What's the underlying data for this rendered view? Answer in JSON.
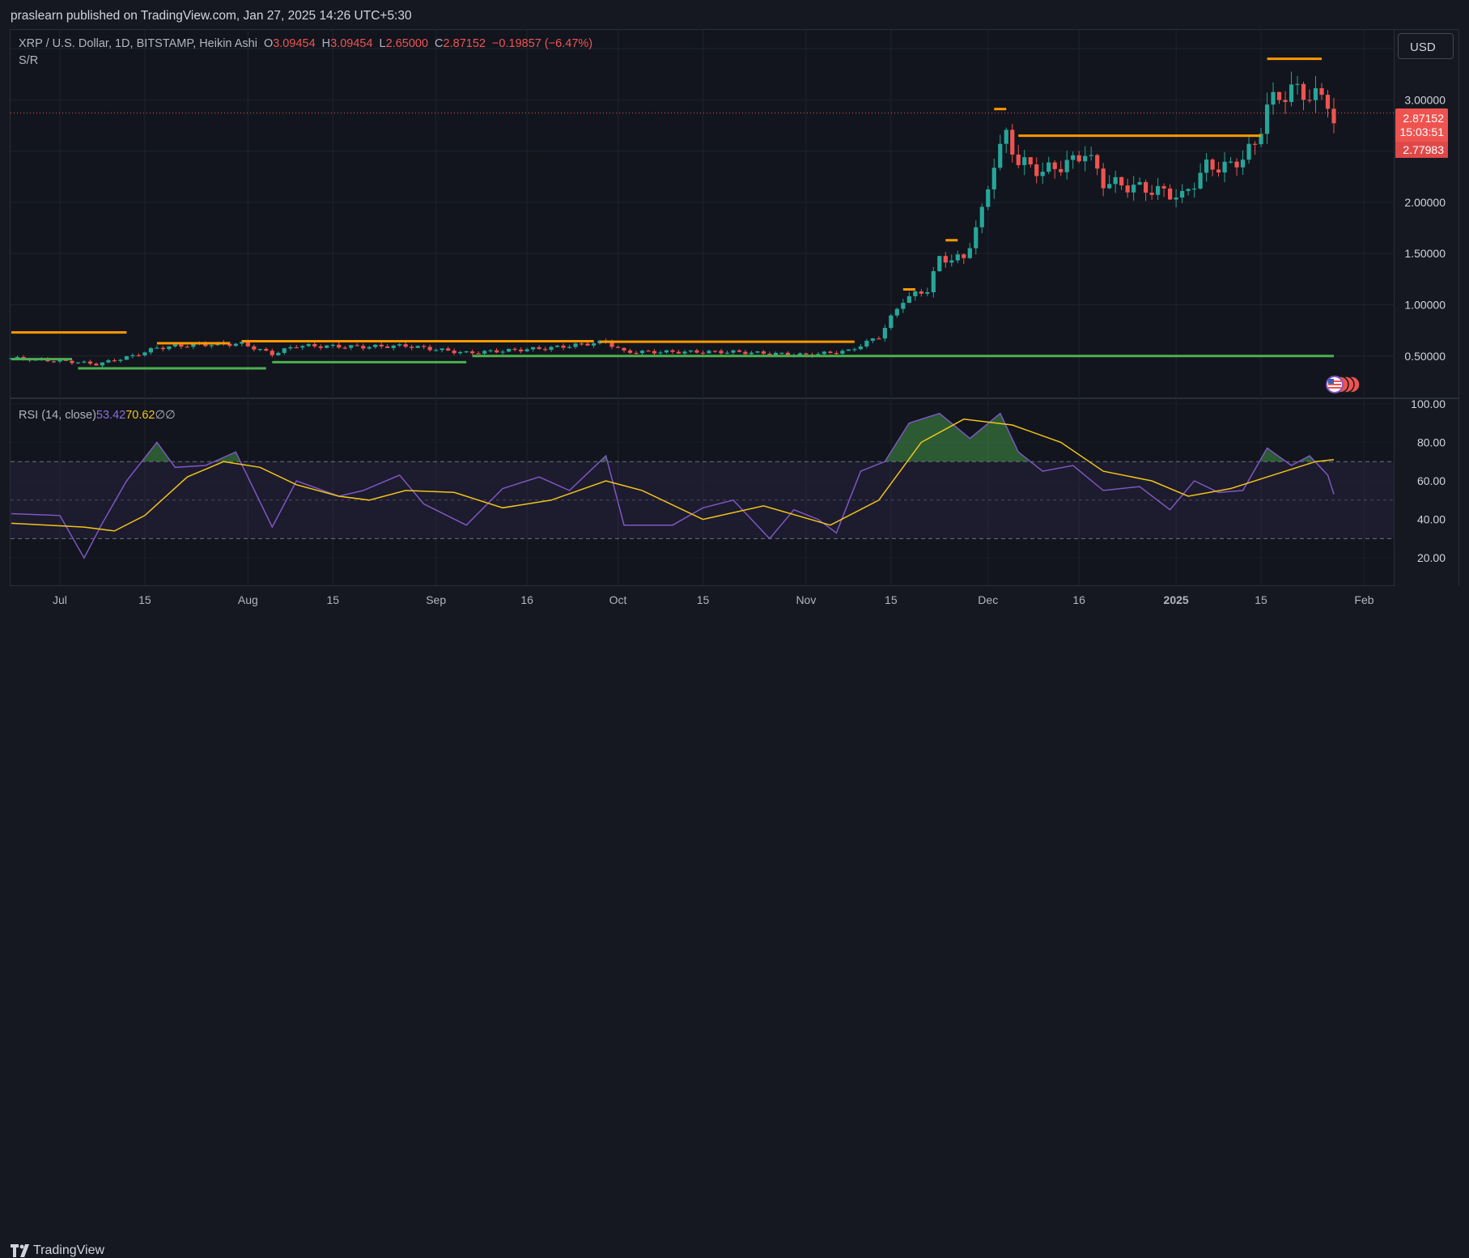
{
  "header": {
    "published_text": "praslearn published on TradingView.com, Jan 27, 2025 14:26 UTC+5:30"
  },
  "legend": {
    "title": "XRP / U.S. Dollar, 1D, BITSTAMP, Heikin Ashi",
    "o_label": "O",
    "o_value": "3.09454",
    "h_label": "H",
    "h_value": "3.09454",
    "l_label": "L",
    "l_value": "2.65000",
    "c_label": "C",
    "c_value": "2.87152",
    "change": "−0.19857 (−6.47%)",
    "indicator": "S/R"
  },
  "rsi_legend": {
    "title": "RSI (14, close)",
    "rsi_value": "53.42",
    "ma_value": "70.62",
    "sym1": "∅",
    "sym2": "∅"
  },
  "currency_button": "USD",
  "price_tags": {
    "last": "2.87152",
    "countdown": "15:03:51",
    "ha_close": "2.77983"
  },
  "footer": {
    "brand": "TradingView"
  },
  "colors": {
    "up": "#26a69a",
    "down": "#ef5350",
    "resistance": "#ff9800",
    "support": "#4caf50",
    "rsi": "#7e57c2",
    "rsi_ma": "#f0c419",
    "background": "#12151d",
    "grid": "#1f232e"
  },
  "chart_data": [
    {
      "type": "candlestick",
      "title": "XRP / U.S. Dollar, 1D, BITSTAMP, Heikin Ashi",
      "ylim": [
        0.0,
        3.6
      ],
      "y_ticks": [
        "0.50000",
        "1.00000",
        "1.50000",
        "2.00000",
        "3.00000"
      ],
      "x_ticks": [
        "Jul",
        "15",
        "Aug",
        "15",
        "Sep",
        "16",
        "Oct",
        "15",
        "Nov",
        "15",
        "Dec",
        "16",
        "2025",
        "15",
        "Feb"
      ],
      "date_range": [
        "2024-06-23",
        "2025-01-27"
      ],
      "close_path": [
        [
          "2024-06-23",
          0.48
        ],
        [
          "2024-07-04",
          0.44
        ],
        [
          "2024-07-07",
          0.42
        ],
        [
          "2024-07-13",
          0.5
        ],
        [
          "2024-07-17",
          0.58
        ],
        [
          "2024-07-23",
          0.61
        ],
        [
          "2024-07-31",
          0.62
        ],
        [
          "2024-08-05",
          0.52
        ],
        [
          "2024-08-09",
          0.6
        ],
        [
          "2024-08-20",
          0.59
        ],
        [
          "2024-08-27",
          0.6
        ],
        [
          "2024-09-06",
          0.53
        ],
        [
          "2024-09-20",
          0.58
        ],
        [
          "2024-09-29",
          0.64
        ],
        [
          "2024-10-02",
          0.54
        ],
        [
          "2024-10-20",
          0.54
        ],
        [
          "2024-11-01",
          0.51
        ],
        [
          "2024-11-08",
          0.55
        ],
        [
          "2024-11-13",
          0.69
        ],
        [
          "2024-11-17",
          1.05
        ],
        [
          "2024-11-21",
          1.15
        ],
        [
          "2024-11-23",
          1.45
        ],
        [
          "2024-11-27",
          1.45
        ],
        [
          "2024-11-30",
          1.9
        ],
        [
          "2024-12-02",
          2.4
        ],
        [
          "2024-12-04",
          2.65
        ],
        [
          "2024-12-06",
          2.4
        ],
        [
          "2024-12-10",
          2.3
        ],
        [
          "2024-12-15",
          2.4
        ],
        [
          "2024-12-17",
          2.5
        ],
        [
          "2024-12-20",
          2.2
        ],
        [
          "2024-12-30",
          2.1
        ],
        [
          "2025-01-02",
          2.05
        ],
        [
          "2025-01-06",
          2.35
        ],
        [
          "2025-01-10",
          2.35
        ],
        [
          "2025-01-14",
          2.55
        ],
        [
          "2025-01-16",
          2.95
        ],
        [
          "2025-01-20",
          3.1
        ],
        [
          "2025-01-26",
          3.0
        ],
        [
          "2025-01-27",
          2.78
        ]
      ],
      "last_price": 2.87152,
      "sr_lines": [
        {
          "kind": "resistance",
          "from": "2024-06-23",
          "to": "2024-07-12",
          "value": 0.73
        },
        {
          "kind": "resistance",
          "from": "2024-07-17",
          "to": "2024-07-29",
          "value": 0.625
        },
        {
          "kind": "resistance",
          "from": "2024-07-31",
          "to": "2024-09-27",
          "value": 0.645
        },
        {
          "kind": "resistance",
          "from": "2024-09-28",
          "to": "2024-11-09",
          "value": 0.64
        },
        {
          "kind": "resistance",
          "from": "2024-11-17",
          "to": "2024-11-19",
          "value": 1.15
        },
        {
          "kind": "resistance",
          "from": "2024-11-24",
          "to": "2024-11-26",
          "value": 1.63
        },
        {
          "kind": "resistance",
          "from": "2024-12-02",
          "to": "2024-12-04",
          "value": 2.91
        },
        {
          "kind": "resistance",
          "from": "2024-12-06",
          "to": "2025-01-15",
          "value": 2.65
        },
        {
          "kind": "resistance",
          "from": "2025-01-16",
          "to": "2025-01-25",
          "value": 3.4
        },
        {
          "kind": "support",
          "from": "2024-06-23",
          "to": "2024-07-03",
          "value": 0.47
        },
        {
          "kind": "support",
          "from": "2024-07-04",
          "to": "2024-08-04",
          "value": 0.38
        },
        {
          "kind": "support",
          "from": "2024-08-05",
          "to": "2024-09-06",
          "value": 0.44
        },
        {
          "kind": "support",
          "from": "2024-09-07",
          "to": "2025-01-27",
          "value": 0.5
        }
      ]
    },
    {
      "type": "line",
      "title": "RSI (14, close)",
      "ylim": [
        10,
        105
      ],
      "y_ticks": [
        "20.00",
        "40.00",
        "60.00",
        "80.00",
        "100.00"
      ],
      "bands": [
        30,
        50,
        70
      ],
      "series": [
        {
          "key": "rsi",
          "points": [
            [
              "2024-06-23",
              43
            ],
            [
              "2024-07-01",
              42
            ],
            [
              "2024-07-05",
              20
            ],
            [
              "2024-07-08",
              38
            ],
            [
              "2024-07-12",
              60
            ],
            [
              "2024-07-17",
              80
            ],
            [
              "2024-07-20",
              67
            ],
            [
              "2024-07-25",
              68
            ],
            [
              "2024-07-30",
              75
            ],
            [
              "2024-08-05",
              36
            ],
            [
              "2024-08-09",
              60
            ],
            [
              "2024-08-16",
              52
            ],
            [
              "2024-08-20",
              55
            ],
            [
              "2024-08-26",
              63
            ],
            [
              "2024-08-30",
              48
            ],
            [
              "2024-09-06",
              37
            ],
            [
              "2024-09-12",
              56
            ],
            [
              "2024-09-18",
              62
            ],
            [
              "2024-09-23",
              55
            ],
            [
              "2024-09-29",
              73
            ],
            [
              "2024-10-02",
              37
            ],
            [
              "2024-10-10",
              37
            ],
            [
              "2024-10-15",
              46
            ],
            [
              "2024-10-20",
              50
            ],
            [
              "2024-10-26",
              30
            ],
            [
              "2024-10-30",
              45
            ],
            [
              "2024-11-03",
              40
            ],
            [
              "2024-11-06",
              33
            ],
            [
              "2024-11-10",
              65
            ],
            [
              "2024-11-14",
              70
            ],
            [
              "2024-11-18",
              90
            ],
            [
              "2024-11-23",
              95
            ],
            [
              "2024-11-28",
              82
            ],
            [
              "2024-12-03",
              95
            ],
            [
              "2024-12-06",
              75
            ],
            [
              "2024-12-10",
              65
            ],
            [
              "2024-12-15",
              68
            ],
            [
              "2024-12-20",
              55
            ],
            [
              "2024-12-26",
              57
            ],
            [
              "2024-12-31",
              45
            ],
            [
              "2025-01-04",
              60
            ],
            [
              "2025-01-08",
              54
            ],
            [
              "2025-01-12",
              55
            ],
            [
              "2025-01-16",
              77
            ],
            [
              "2025-01-20",
              68
            ],
            [
              "2025-01-23",
              73
            ],
            [
              "2025-01-26",
              63
            ],
            [
              "2025-01-27",
              53
            ]
          ]
        },
        {
          "key": "rsi_ma",
          "points": [
            [
              "2024-06-23",
              38
            ],
            [
              "2024-07-05",
              36
            ],
            [
              "2024-07-10",
              34
            ],
            [
              "2024-07-15",
              42
            ],
            [
              "2024-07-22",
              62
            ],
            [
              "2024-07-28",
              70
            ],
            [
              "2024-08-03",
              67
            ],
            [
              "2024-08-09",
              58
            ],
            [
              "2024-08-16",
              52
            ],
            [
              "2024-08-21",
              50
            ],
            [
              "2024-08-27",
              55
            ],
            [
              "2024-09-04",
              54
            ],
            [
              "2024-09-12",
              46
            ],
            [
              "2024-09-20",
              50
            ],
            [
              "2024-09-29",
              60
            ],
            [
              "2024-10-05",
              55
            ],
            [
              "2024-10-15",
              40
            ],
            [
              "2024-10-25",
              47
            ],
            [
              "2024-11-05",
              37
            ],
            [
              "2024-11-13",
              50
            ],
            [
              "2024-11-20",
              80
            ],
            [
              "2024-11-27",
              92
            ],
            [
              "2024-12-05",
              89
            ],
            [
              "2024-12-13",
              80
            ],
            [
              "2024-12-20",
              65
            ],
            [
              "2024-12-28",
              60
            ],
            [
              "2025-01-03",
              52
            ],
            [
              "2025-01-10",
              56
            ],
            [
              "2025-01-16",
              62
            ],
            [
              "2025-01-24",
              70
            ],
            [
              "2025-01-27",
              71
            ]
          ]
        }
      ]
    }
  ]
}
